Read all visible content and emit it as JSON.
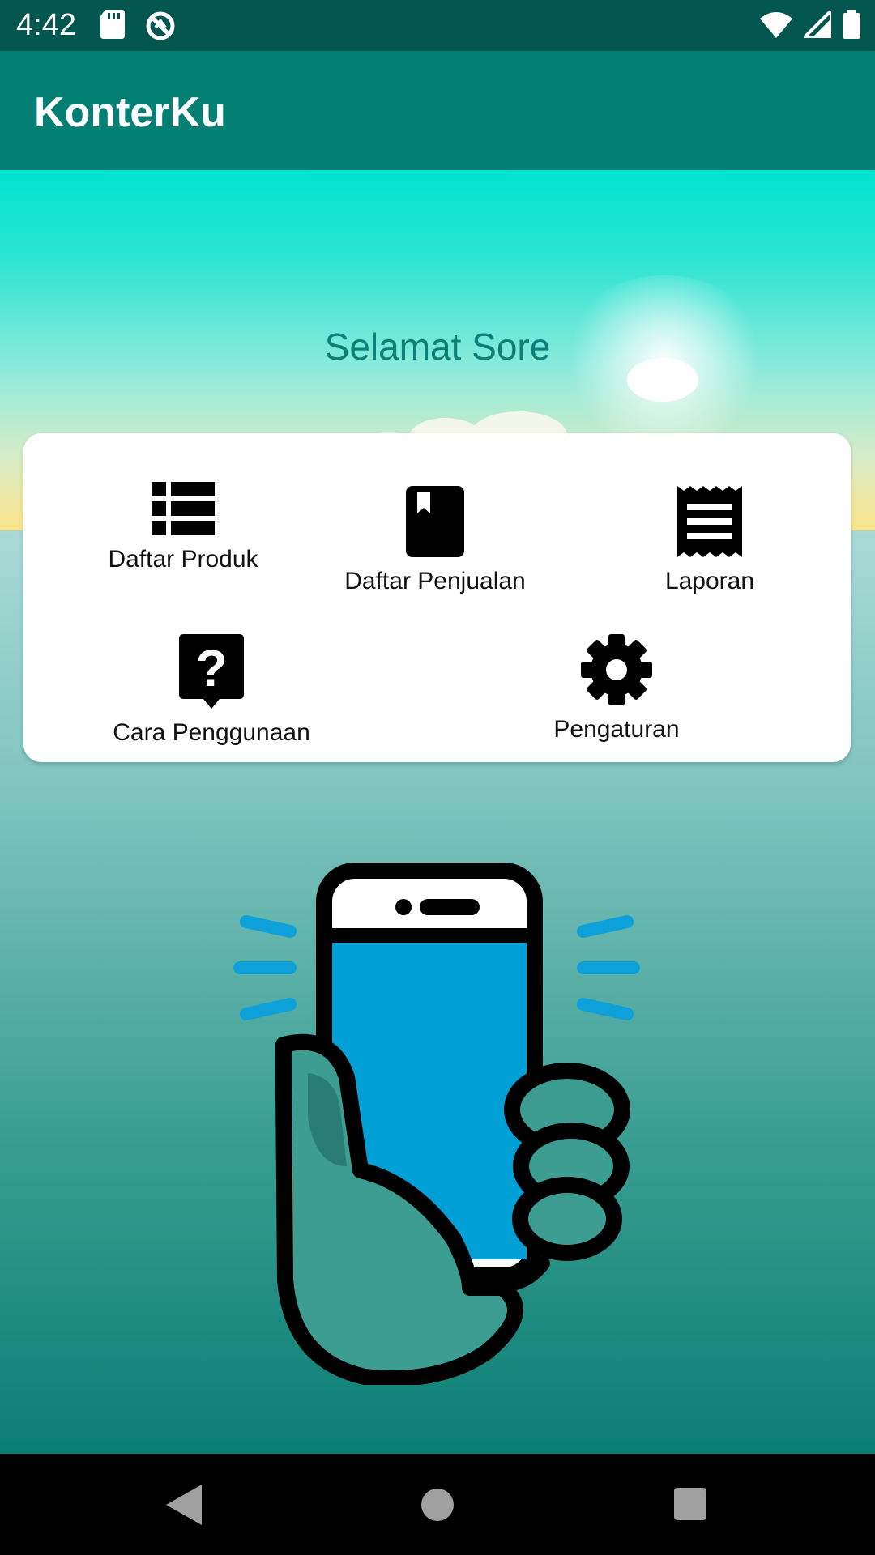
{
  "status_bar": {
    "time": "4:42",
    "left_icons": [
      "sd-card-icon",
      "sync-icon"
    ],
    "right_icons": [
      "wifi-icon",
      "signal-icon",
      "battery-icon"
    ]
  },
  "app_bar": {
    "title": "KonterKu",
    "color": "#037f73"
  },
  "header": {
    "greeting": "Selamat Sore"
  },
  "menu": {
    "items": [
      {
        "label": "Daftar Produk",
        "icon": "list-icon"
      },
      {
        "label": "Daftar Penjualan",
        "icon": "book-icon"
      },
      {
        "label": "Laporan",
        "icon": "receipt-icon"
      },
      {
        "label": "Cara Penggunaan",
        "icon": "help-icon"
      },
      {
        "label": "Pengaturan",
        "icon": "gear-icon"
      }
    ]
  },
  "illustration": {
    "icon": "hand-holding-phone-illustration"
  },
  "nav_bar": {
    "buttons": [
      "back-icon",
      "home-icon",
      "recents-icon"
    ]
  },
  "colors": {
    "status_bar": "#04574f",
    "accent": "#0b7f78",
    "phone_screen": "#00a0d6"
  }
}
